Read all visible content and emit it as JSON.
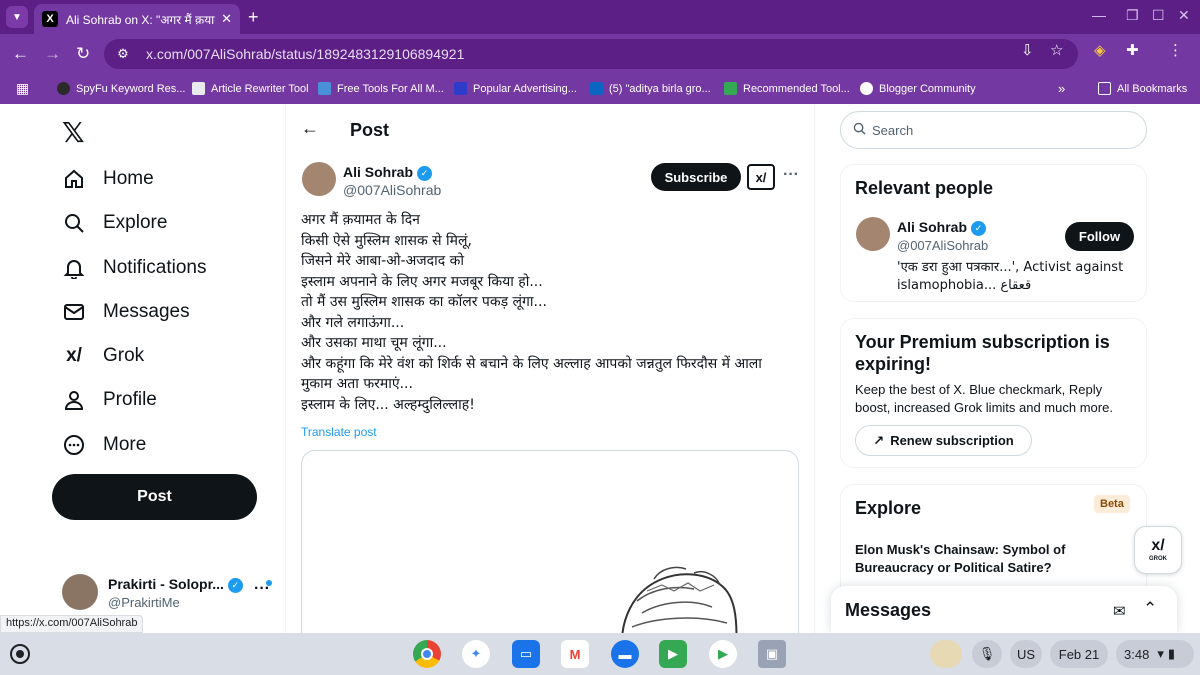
{
  "browser": {
    "tab_title": "Ali Sohrab on X: \"अगर मैं क़यामत",
    "url": "x.com/007AliSohrab/status/1892483129106894921",
    "bookmarks": [
      {
        "label": "SpyFu Keyword Res...",
        "color": "#2b2b2b"
      },
      {
        "label": "Article Rewriter Tool",
        "color": "#e8eaed"
      },
      {
        "label": "Free Tools For All M...",
        "color": "#4a90d9"
      },
      {
        "label": "Popular Advertising...",
        "color": "#2d3cc9"
      },
      {
        "label": "(5) \"aditya birla gro...",
        "color": "#0a66c2"
      },
      {
        "label": "Recommended Tool...",
        "color": "#34a853"
      },
      {
        "label": "Blogger Community",
        "color": "#ffffff"
      }
    ],
    "all_bookmarks": "All Bookmarks",
    "status_url": "https://x.com/007AliSohrab"
  },
  "nav": {
    "items": [
      {
        "label": "Home",
        "icon": "home-icon"
      },
      {
        "label": "Explore",
        "icon": "search-icon"
      },
      {
        "label": "Notifications",
        "icon": "bell-icon"
      },
      {
        "label": "Messages",
        "icon": "mail-icon"
      },
      {
        "label": "Grok",
        "icon": "grok-icon"
      },
      {
        "label": "Profile",
        "icon": "person-icon"
      },
      {
        "label": "More",
        "icon": "more-circle-icon"
      }
    ],
    "post_button": "Post",
    "account": {
      "name": "Prakirti - Solopr...",
      "handle": "@PrakirtiMe"
    }
  },
  "post": {
    "header": "Post",
    "author": {
      "name": "Ali Sohrab",
      "handle": "@007AliSohrab"
    },
    "subscribe": "Subscribe",
    "lines": [
      "अगर मैं क़यामत के दिन",
      "किसी ऐसे मुस्लिम शासक से मिलूं,",
      "जिसने मेरे आबा-ओ-अजदाद को",
      "इस्लाम अपनाने के लिए अगर मजबूर किया हो...",
      "तो मैं उस मुस्लिम शासक का कॉलर पकड़ लूंगा...",
      "और गले लगाऊंगा...",
      "और उसका माथा चूम लूंगा...",
      "और कहूंगा कि मेरे वंश को शिर्क से बचाने के लिए अल्लाह आपको जन्नतुल फिरदौस में आला",
      "मुकाम अता फरमाएं...",
      "इस्लाम के लिए... अल्हम्दुलिल्लाह!"
    ],
    "translate": "Translate post"
  },
  "sidebar": {
    "search_placeholder": "Search",
    "relevant": {
      "title": "Relevant people",
      "name": "Ali Sohrab",
      "handle": "@007AliSohrab",
      "follow": "Follow",
      "bio_line1": "'एक डरा हुआ पत्रकार...', Activist against",
      "bio_line2": "islamophobia... قعقاع"
    },
    "premium": {
      "title_line1": "Your Premium subscription is",
      "title_line2": "expiring!",
      "body_line1": "Keep the best of X. Blue checkmark, Reply",
      "body_line2": "boost, increased Grok limits and much more.",
      "renew": "Renew subscription"
    },
    "explore": {
      "title": "Explore",
      "badge": "Beta",
      "headline_line1": "Elon Musk's Chainsaw: Symbol of",
      "headline_line2": "Bureaucracy or Political Satire?"
    },
    "grok_label": "GROK",
    "messages": "Messages"
  },
  "taskbar": {
    "lang": "US",
    "date": "Feb 21",
    "time": "3:48"
  },
  "colors": {
    "browser_frame": "#7438a2",
    "tabstrip": "#5b1f86",
    "x_black": "#0f1419",
    "x_blue": "#1d9bf0"
  }
}
